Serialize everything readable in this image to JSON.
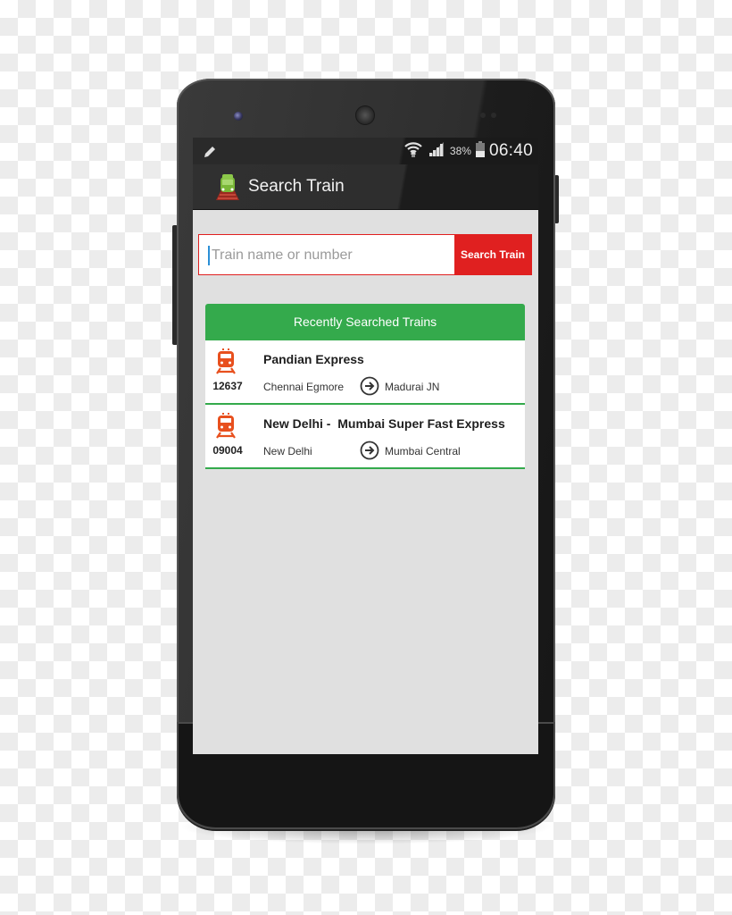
{
  "status_bar": {
    "battery_percent": "38%",
    "time": "06:40",
    "icons": [
      "pencil-icon",
      "wifi-icon",
      "signal-icon",
      "battery-icon"
    ]
  },
  "action_bar": {
    "title": "Search Train",
    "icon": "train-app-icon"
  },
  "search": {
    "placeholder": "Train name or number",
    "value": "",
    "button_label": "Search Train"
  },
  "recent": {
    "header": "Recently Searched Trains",
    "trains": [
      {
        "number": "12637",
        "name": "Pandian Express",
        "from": "Chennai Egmore",
        "to": "Madurai JN"
      },
      {
        "number": "09004",
        "name": "New Delhi -  Mumbai Super Fast Express",
        "from": "New Delhi",
        "to": "Mumbai Central"
      }
    ]
  },
  "colors": {
    "accent_green": "#34aa4c",
    "accent_red": "#e02020",
    "train_icon": "#e8501e",
    "screen_bg": "#e0e0e0"
  }
}
